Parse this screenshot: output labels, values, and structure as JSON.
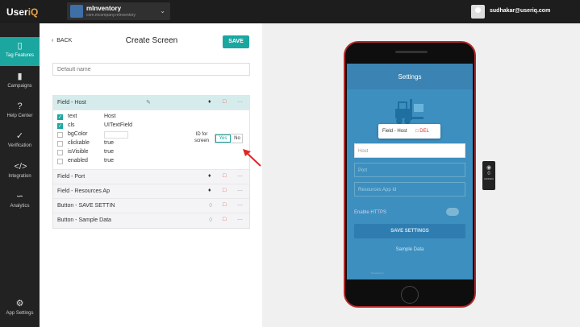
{
  "topbar": {
    "logo_main": "User",
    "logo_accent": "iQ",
    "app_name": "mInventory",
    "app_bundle": "com.mcompany.mInventory",
    "user_email": "sudhakar@useriq.com"
  },
  "sidebar": {
    "items": [
      {
        "label": "Tag Features",
        "icon": "phone-icon",
        "active": true
      },
      {
        "label": "Campaigns",
        "icon": "campaign-icon"
      },
      {
        "label": "Help Center",
        "icon": "help-icon"
      },
      {
        "label": "Verification",
        "icon": "check-circle-icon"
      },
      {
        "label": "Integration",
        "icon": "code-icon"
      },
      {
        "label": "Analytics",
        "icon": "analytics-icon"
      },
      {
        "label": "App Settings",
        "icon": "gear-icon"
      }
    ]
  },
  "panel": {
    "back_label": "BACK",
    "title": "Create Screen",
    "save_label": "SAVE",
    "name_placeholder": "Default name",
    "fields": [
      {
        "label": "Field - Host"
      },
      {
        "label": "Field - Port"
      },
      {
        "label": "Field - Resources Ap"
      },
      {
        "label": "Button - SAVE SETTIN"
      },
      {
        "label": "Button - Sample Data"
      }
    ],
    "props": [
      {
        "name": "text",
        "value": "Host",
        "checked": true
      },
      {
        "name": "cls",
        "value": "UITextField",
        "checked": true
      },
      {
        "name": "bgColor",
        "value": "",
        "checked": false
      },
      {
        "name": "clickable",
        "value": "true",
        "checked": false
      },
      {
        "name": "isVisible",
        "value": "true",
        "checked": false
      },
      {
        "name": "enabled",
        "value": "true",
        "checked": false
      }
    ],
    "id_for_screen_1": "ID for",
    "id_for_screen_2": "screen",
    "yes_label": "Yes",
    "no_label": "No"
  },
  "phone": {
    "header": "Settings",
    "tooltip_label": "Field - Host",
    "tooltip_del": "DEL",
    "host_placeholder": "Host",
    "port_placeholder": "Port",
    "resources_placeholder": "Resources App Id",
    "https_label": "Enable HTTPS",
    "save_settings": "SAVE SETTINGS",
    "sample_data": "Sample Data",
    "powered_by": "Powered by"
  },
  "device_control": {
    "count": "0",
    "label": "HIDDEN"
  },
  "colors": {
    "accent": "#1ba6a0",
    "sidebar": "#222222",
    "topbar": "#1d1d1d",
    "phone_screen": "#3d8fbf"
  }
}
